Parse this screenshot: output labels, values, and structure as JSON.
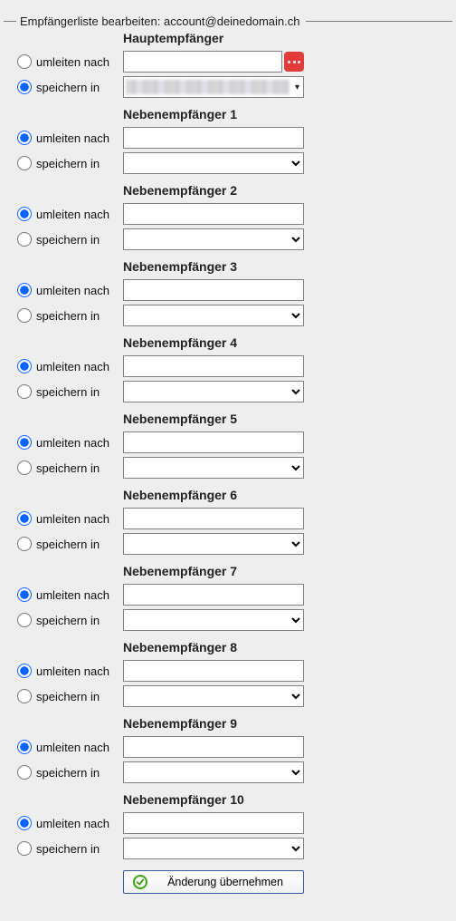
{
  "legend": "Empfängerliste bearbeiten: account@deinedomain.ch",
  "labels": {
    "redirect": "umleiten nach",
    "store": "speichern in"
  },
  "submit_label": "Änderung übernehmen",
  "main": {
    "title": "Hauptempfänger",
    "selected": "store",
    "redirect_value": "",
    "store_value": ""
  },
  "secondary": [
    {
      "title": "Nebenempfänger 1",
      "selected": "redirect",
      "redirect_value": "",
      "store_value": ""
    },
    {
      "title": "Nebenempfänger 2",
      "selected": "redirect",
      "redirect_value": "",
      "store_value": ""
    },
    {
      "title": "Nebenempfänger 3",
      "selected": "redirect",
      "redirect_value": "",
      "store_value": ""
    },
    {
      "title": "Nebenempfänger 4",
      "selected": "redirect",
      "redirect_value": "",
      "store_value": ""
    },
    {
      "title": "Nebenempfänger 5",
      "selected": "redirect",
      "redirect_value": "",
      "store_value": ""
    },
    {
      "title": "Nebenempfänger 6",
      "selected": "redirect",
      "redirect_value": "",
      "store_value": ""
    },
    {
      "title": "Nebenempfänger 7",
      "selected": "redirect",
      "redirect_value": "",
      "store_value": ""
    },
    {
      "title": "Nebenempfänger 8",
      "selected": "redirect",
      "redirect_value": "",
      "store_value": ""
    },
    {
      "title": "Nebenempfänger 9",
      "selected": "redirect",
      "redirect_value": "",
      "store_value": ""
    },
    {
      "title": "Nebenempfänger 10",
      "selected": "redirect",
      "redirect_value": "",
      "store_value": ""
    }
  ]
}
